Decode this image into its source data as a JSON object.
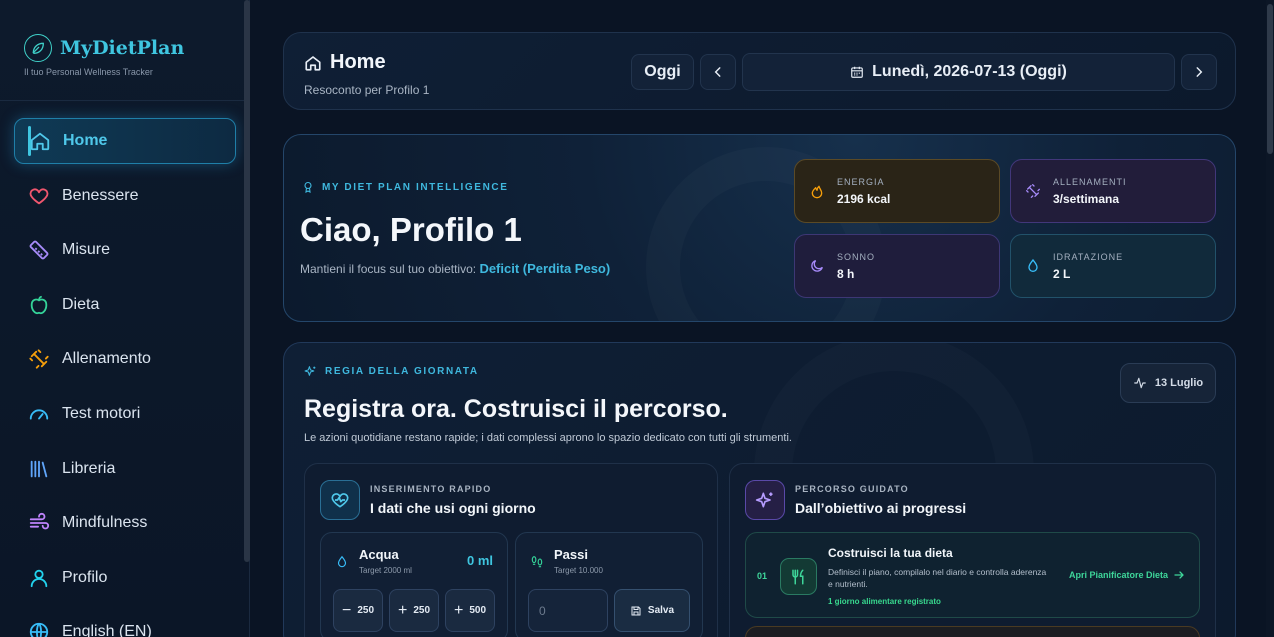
{
  "brand": {
    "name": "MyDietPlan",
    "tagline": "Il tuo Personal Wellness Tracker"
  },
  "sidebar": {
    "items": [
      {
        "label": "Home",
        "icon": "home-icon",
        "color": "#4fc8ea",
        "active": true
      },
      {
        "label": "Benessere",
        "icon": "heart-icon",
        "color": "#f0566e"
      },
      {
        "label": "Misure",
        "icon": "ruler-icon",
        "color": "#a78bfa"
      },
      {
        "label": "Dieta",
        "icon": "apple-icon",
        "color": "#34d399"
      },
      {
        "label": "Allenamento",
        "icon": "dumbbell-icon",
        "color": "#f59e0b"
      },
      {
        "label": "Test motori",
        "icon": "gauge-icon",
        "color": "#38bdf8"
      },
      {
        "label": "Libreria",
        "icon": "library-icon",
        "color": "#60a5fa"
      },
      {
        "label": "Mindfulness",
        "icon": "wind-icon",
        "color": "#c084fc"
      },
      {
        "label": "Profilo",
        "icon": "user-icon",
        "color": "#22d3ee"
      },
      {
        "label": "English (EN)",
        "icon": "globe-icon",
        "color": "#38bdf8"
      }
    ]
  },
  "header": {
    "title": "Home",
    "subtitle": "Resoconto per Profilo 1",
    "today_label": "Oggi",
    "date_label": "Lunedì, 2026-07-13 (Oggi)"
  },
  "hero": {
    "kicker": "MY DIET PLAN INTELLIGENCE",
    "greeting": "Ciao, Profilo 1",
    "focus_prefix": "Mantieni il focus sul tuo obiettivo:",
    "focus_goal": "Deficit (Perdita Peso)",
    "stats": {
      "energia": {
        "label": "ENERGIA",
        "value": "2196 kcal",
        "icon": "flame-icon"
      },
      "allenamenti": {
        "label": "ALLENAMENTI",
        "value": "3/settimana",
        "icon": "dumbbell-icon"
      },
      "sonno": {
        "label": "SONNO",
        "value": "8 h",
        "icon": "moon-icon"
      },
      "idratazione": {
        "label": "IDRATAZIONE",
        "value": "2 L",
        "icon": "droplet-icon"
      }
    }
  },
  "regia": {
    "kicker": "REGIA DELLA GIORNATA",
    "title": "Registra ora. Costruisci il percorso.",
    "description": "Le azioni quotidiane restano rapide; i dati complessi aprono lo spazio dedicato con tutti gli strumenti.",
    "date_pill": "13 Luglio",
    "quick": {
      "kicker": "INSERIMENTO RAPIDO",
      "title": "I dati che usi ogni giorno",
      "water": {
        "label": "Acqua",
        "target": "Target 2000 ml",
        "value": "0 ml",
        "buttons": [
          {
            "op": "−",
            "amount": "250"
          },
          {
            "op": "+",
            "amount": "250"
          },
          {
            "op": "+",
            "amount": "500"
          }
        ]
      },
      "steps": {
        "label": "Passi",
        "target": "Target 10.000",
        "placeholder": "0",
        "save_label": "Salva"
      }
    },
    "guided": {
      "kicker": "PERCORSO GUIDATO",
      "title": "Dall’obiettivo ai progressi",
      "step1": {
        "number": "01",
        "title": "Costruisci la tua dieta",
        "description": "Definisci il piano, compilalo nel diario e controlla aderenza e nutrienti.",
        "status": "1 giorno alimentare registrato",
        "link": "Apri Pianificatore Dieta"
      }
    }
  }
}
